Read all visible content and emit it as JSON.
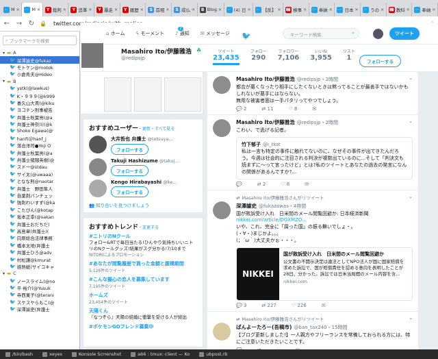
{
  "browser": {
    "tabs": [
      {
        "label": "M",
        "color": "#1da1f2",
        "glyph": "🐦"
      },
      {
        "label": "M",
        "color": "#1da1f2",
        "glyph": "🐦",
        "active": true
      },
      {
        "label": "裁判",
        "color": "#d00",
        "glyph": "Y"
      },
      {
        "label": "追準",
        "color": "#d00",
        "glyph": "Y"
      },
      {
        "label": "暴走",
        "color": "#d00",
        "glyph": "Y"
      },
      {
        "label": "履歴",
        "color": "#d00",
        "glyph": "Y"
      },
      {
        "label": "首相",
        "color": "#4a90d9",
        "glyph": "S"
      },
      {
        "label": "成仏",
        "color": "#4a90d9",
        "glyph": "S"
      },
      {
        "label": "Blog",
        "color": "#444",
        "glyph": "B"
      },
      {
        "label": "(4) 日",
        "color": "#1da1f2",
        "glyph": "🐦"
      },
      {
        "label": "【反】",
        "color": "#1da1f2",
        "glyph": "🐦"
      },
      {
        "label": "検事",
        "color": "#c00",
        "glyph": "📰"
      },
      {
        "label": "奉納",
        "color": "#1da1f2",
        "glyph": "🐦"
      },
      {
        "label": "日本",
        "color": "#1da1f2",
        "glyph": "🐦"
      },
      {
        "label": "うの",
        "color": "#1da1f2",
        "glyph": "🐦"
      },
      {
        "label": "教科",
        "color": "#c00",
        "glyph": "📰"
      },
      {
        "label": "奉納",
        "color": "#1da1f2",
        "glyph": "🐦"
      }
    ],
    "url": "twitter.com/redipsjp/with_replies"
  },
  "sidebar": {
    "search_placeholder": "ブックマークを検索",
    "items": [
      {
        "label": "A",
        "type": "folder"
      },
      {
        "label": "深澤諭史@fukaz",
        "type": "bm",
        "selected": true
      },
      {
        "label": "モトケン@motok",
        "type": "bm"
      },
      {
        "label": "小倉秀夫@Hideo",
        "type": "bm"
      },
      {
        "label": "B",
        "type": "folder"
      },
      {
        "label": "ystk(@lawkus)",
        "type": "bm"
      },
      {
        "label": "K・９９９(@k999",
        "type": "bm"
      },
      {
        "label": "喜久山大貴(@kiku",
        "type": "bm"
      },
      {
        "label": "ヨコチン刑事被告",
        "type": "bm"
      },
      {
        "label": "弁護士秋葉亮(@a",
        "type": "bm"
      },
      {
        "label": "弁護士神奈川(@k",
        "type": "bm"
      },
      {
        "label": "Shoko Egawa(@",
        "type": "bm"
      },
      {
        "label": "hanf(＠hanf_j",
        "type": "bm"
      },
      {
        "label": "落合洋司●Yoji O",
        "type": "bm"
      },
      {
        "label": "弁護士秋葉亮(@a",
        "type": "bm"
      },
      {
        "label": "弁護士猪隈英樹(@",
        "type": "bm"
      },
      {
        "label": "スド一@stdau",
        "type": "bm"
      },
      {
        "label": "サイ太(@uwaaa)",
        "type": "bm"
      },
      {
        "label": "となな刑@naotar",
        "type": "bm"
      },
      {
        "label": "弁護士　野田隼人",
        "type": "bm"
      },
      {
        "label": "自薬剤パンチェッ",
        "type": "bm"
      },
      {
        "label": "強刺わいすず(@ka",
        "type": "bm"
      },
      {
        "label": "こたぴん(@kotap",
        "type": "bm"
      },
      {
        "label": "坂本正幸(@sakan",
        "type": "bm"
      },
      {
        "label": "弁護士おだちだ(",
        "type": "bm"
      },
      {
        "label": "高島章(弁護士)(",
        "type": "bm"
      },
      {
        "label": "向原総合法律事務",
        "type": "bm"
      },
      {
        "label": "橋本太地(弁護士",
        "type": "bm"
      },
      {
        "label": "弁護士ひろ@adv",
        "type": "bm"
      },
      {
        "label": "村松謙@kmurat",
        "type": "bm"
      },
      {
        "label": "感熱紙(サイコキャ",
        "type": "bm"
      },
      {
        "label": "C",
        "type": "folder"
      },
      {
        "label": "ノースライム(@no",
        "type": "bm"
      },
      {
        "label": "平 裕介(@Yusuk",
        "type": "bm"
      },
      {
        "label": "寺西寛子(@terani",
        "type": "bm"
      },
      {
        "label": "スケスヤらもこ(@",
        "type": "bm"
      },
      {
        "label": "深澤諭史(弁護士",
        "type": "bm"
      }
    ]
  },
  "twitter": {
    "nav": {
      "home": "ホーム",
      "moments": "モーメント",
      "notifications": "通知",
      "notif_count": "2",
      "messages": "メッセージ",
      "search_placeholder": "キーワード検索",
      "tweet_button": "ツイート"
    },
    "profile": {
      "name": "Masahiro Ito/伊藤雅浩",
      "handle": "@redipsjp",
      "stats": [
        {
          "label": "ツイート",
          "value": "23,435"
        },
        {
          "label": "フォロー",
          "value": "290"
        },
        {
          "label": "フォロワー",
          "value": "7,106"
        },
        {
          "label": "いいね",
          "value": "3,955"
        },
        {
          "label": "リスト",
          "value": "1"
        }
      ],
      "follow_label": "フォローする"
    },
    "who_to_follow": {
      "title": "おすすめユーザー",
      "refresh": "・更新・すべて見る",
      "users": [
        {
          "name": "大井哲也 弁護士",
          "handle": "@tetsuya..."
        },
        {
          "name": "Takuji Hashizume",
          "handle": "@takuj..."
        },
        {
          "name": "Kengo Hirabayashi",
          "handle": "@ke..."
        }
      ],
      "follow_label": "フォローする",
      "find_friends": "知り合いを見つけましょう"
    },
    "trends": {
      "title": "おすすめトレンド",
      "change": "・変更する",
      "items": [
        {
          "tag": "#ニトリのNクール",
          "desc": "フォロー&RTで毎日当たる!ひんやり気持ちいいニトリのNクールグッズ!結果がスグ分かる!7/10まで",
          "meta": "NITORIによるプロモーション"
        },
        {
          "tag": "#あなたが閲覧履歴で買った金額と腹構期間",
          "desc": "",
          "meta": "5,126件のツイート"
        },
        {
          "tag": "#こんな擬心の恋人を募集しています",
          "desc": "",
          "meta": "7,195件のツイート"
        },
        {
          "tag": "ホームズ",
          "desc": "",
          "meta": "23,454件のツイート"
        },
        {
          "tag": "天陽くん",
          "desc": "『なつぞら』天陽の結婚に衝撃を受ける人が続出",
          "meta": ""
        },
        {
          "tag": "#ポケモンGOフレンド募集中",
          "desc": "",
          "meta": ""
        }
      ]
    },
    "tweets": [
      {
        "name": "Masahiro Ito/伊藤雅浩",
        "handle": "@redipsjp・2時間",
        "text": "都合が悪くなったり相手にしたくないときは黙ってることが最善手ではないかもしれないが悪手にはならない。\n無用な被害者面は一手パタリってやつでしょう。",
        "replies": "2",
        "retweets": "11",
        "likes": "8"
      },
      {
        "name": "Masahiro Ito/伊藤雅浩",
        "handle": "@redipsjp・2時間",
        "text": "こわい、で逃げる記者。",
        "quote_name": "竹下郁子",
        "quote_handle": "@i_tkst",
        "quote_text": "私は一言も特定の事件に触れてないのに、なぜその事件が出てきたんだろう。今週は社会的に注目される判決が複数出ているのに...そして「判決文も読まずに〜って言ったけど」とは?私のツイートとあなたの過去の発言になんの関係があるんですか?...",
        "replies": "",
        "retweets": "2",
        "likes": "8"
      },
      {
        "rt_label": "Masahiro Ito/伊藤雅浩さんがリツイート",
        "name": "深澤諭史",
        "handle": "@fukazawas・4時間",
        "text": "国が敗訴受け入れ　日米間のメール閲覧回避か: 日本経済新聞",
        "link": "nikkei.com/article/DGXMZO...",
        "text2": "いや、これ、完全に「腐った国」の振る舞いでしょ・。\n(・∀・)まじかよ。。。\n(；´ω｀)大丈夫かぉ・・・。",
        "card_title": "国が敗訴受け入れ　日米間のメール閲覧回避か",
        "card_desc": "公文書の不開示決定は違法としてNPO法人が国に国家賠償を求めた訴訟で、国が賠償責任を認める意向を表明したことが28日、分かった。訴訟では日米当局間のメール内容を含...",
        "card_domain": "nikkei.com",
        "card_brand": "NIKKEI",
        "replies": "3",
        "retweets": "227",
        "likes": "226"
      },
      {
        "rt_label": "Masahiro Ito/伊藤雅浩さんがリツイート",
        "name": "ぱんよーたろー(吾稿市)",
        "handle": "@ban_tax240・15時間",
        "text": "【ブログ更新しました!】一人親方やフリーランスを常備しておられる方には、特にご注意いただきたいことです。",
        "replies": "",
        "retweets": "",
        "likes": ""
      }
    ]
  },
  "taskbar": {
    "items": [
      "/bin/bash",
      "xeyes",
      "Konsole Scrrenshot",
      "a66 : tmux: client — Ko",
      "ubpost.rb"
    ]
  }
}
